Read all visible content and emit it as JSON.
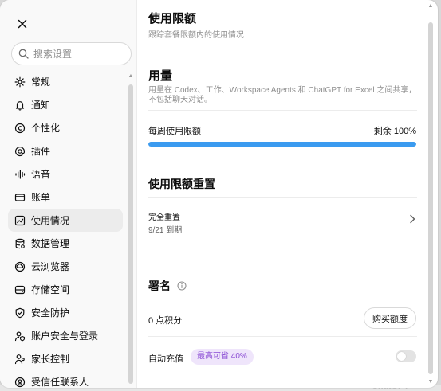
{
  "sidebar": {
    "search_placeholder": "搜索设置",
    "items": [
      {
        "label": "常规",
        "icon": "gear-icon"
      },
      {
        "label": "通知",
        "icon": "bell-icon"
      },
      {
        "label": "个性化",
        "icon": "personalize-icon"
      },
      {
        "label": "插件",
        "icon": "at-icon"
      },
      {
        "label": "语音",
        "icon": "waveform-icon"
      },
      {
        "label": "账单",
        "icon": "card-icon"
      },
      {
        "label": "使用情况",
        "icon": "chart-icon",
        "active": true
      },
      {
        "label": "数据管理",
        "icon": "database-icon"
      },
      {
        "label": "云浏览器",
        "icon": "cloud-icon"
      },
      {
        "label": "存储空间",
        "icon": "storage-icon"
      },
      {
        "label": "安全防护",
        "icon": "shield-icon"
      },
      {
        "label": "账户安全与登录",
        "icon": "account-security-icon"
      },
      {
        "label": "家长控制",
        "icon": "parent-icon"
      },
      {
        "label": "受信任联系人",
        "icon": "trusted-contact-icon"
      }
    ]
  },
  "main": {
    "title": "使用限额",
    "subtitle": "跟踪套餐限额内的使用情况",
    "usage": {
      "title": "用量",
      "description": "用量在 Codex、工作、Workspace Agents 和 ChatGPT for Excel 之间共享，不包括聊天对话。",
      "weekly_label": "每周使用限额",
      "remaining_text": "剩余 100%",
      "remaining_fraction": 1.0
    },
    "reset": {
      "title": "使用限额重置",
      "item_title": "完全重置",
      "item_date": "9/21 到期"
    },
    "credits": {
      "title": "署名",
      "balance": "0 点积分",
      "buy_label": "购买额度",
      "auto_topup_label": "自动充值",
      "auto_topup_badge": "最高可省 40%",
      "auto_topup_enabled": false
    }
  },
  "background": {
    "ghost_text": "ChatGPT"
  },
  "colors": {
    "progress": "#3b9bf0",
    "badge_bg": "#efe5fb",
    "badge_text": "#8a4bd4",
    "active_nav_bg": "#ececec"
  }
}
